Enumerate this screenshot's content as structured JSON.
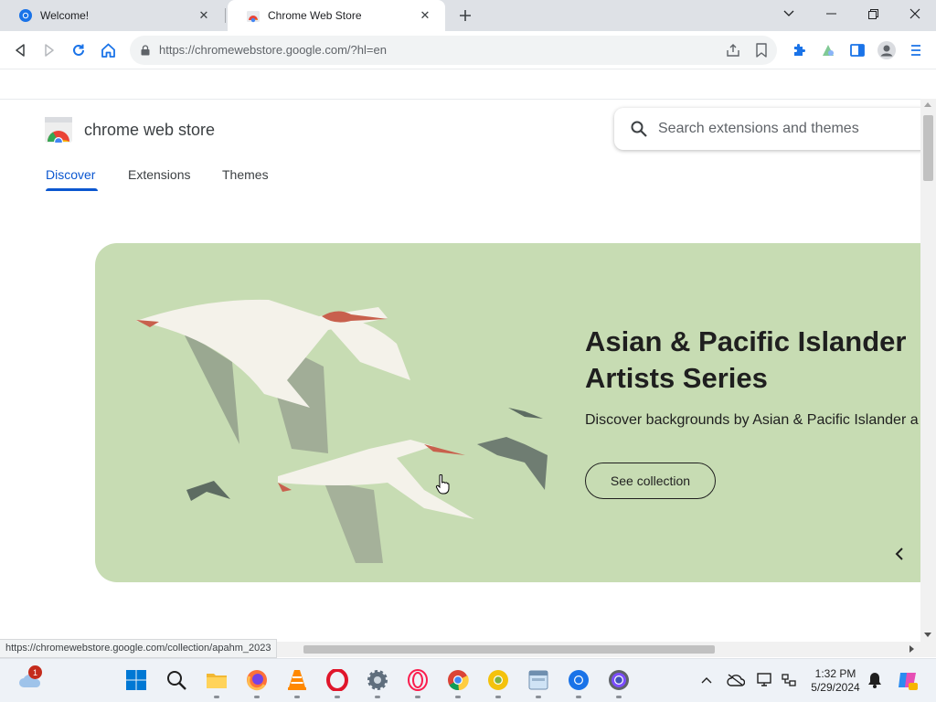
{
  "browser": {
    "tabs": [
      {
        "title": "Welcome!",
        "favicon": "chrome-shield-icon",
        "active": false
      },
      {
        "title": "Chrome Web Store",
        "favicon": "chrome-web-store-icon",
        "active": true
      }
    ],
    "url": "https://chromewebstore.google.com/?hl=en",
    "status_url": "https://chromewebstore.google.com/collection/apahm_2023"
  },
  "store": {
    "name": "chrome web store",
    "search_placeholder": "Search extensions and themes",
    "nav_tabs": [
      {
        "label": "Discover",
        "active": true
      },
      {
        "label": "Extensions",
        "active": false
      },
      {
        "label": "Themes",
        "active": false
      }
    ],
    "hero": {
      "title_line1": "Asian & Pacific Islander",
      "title_line2": "Artists Series",
      "description": "Discover backgrounds by Asian & Pacific Islander a",
      "button_label": "See collection",
      "background_color": "#c7dcb3"
    },
    "accent_color": "#0b57d0"
  },
  "taskbar": {
    "weather_badge": "1",
    "time": "1:32 PM",
    "date": "5/29/2024"
  }
}
